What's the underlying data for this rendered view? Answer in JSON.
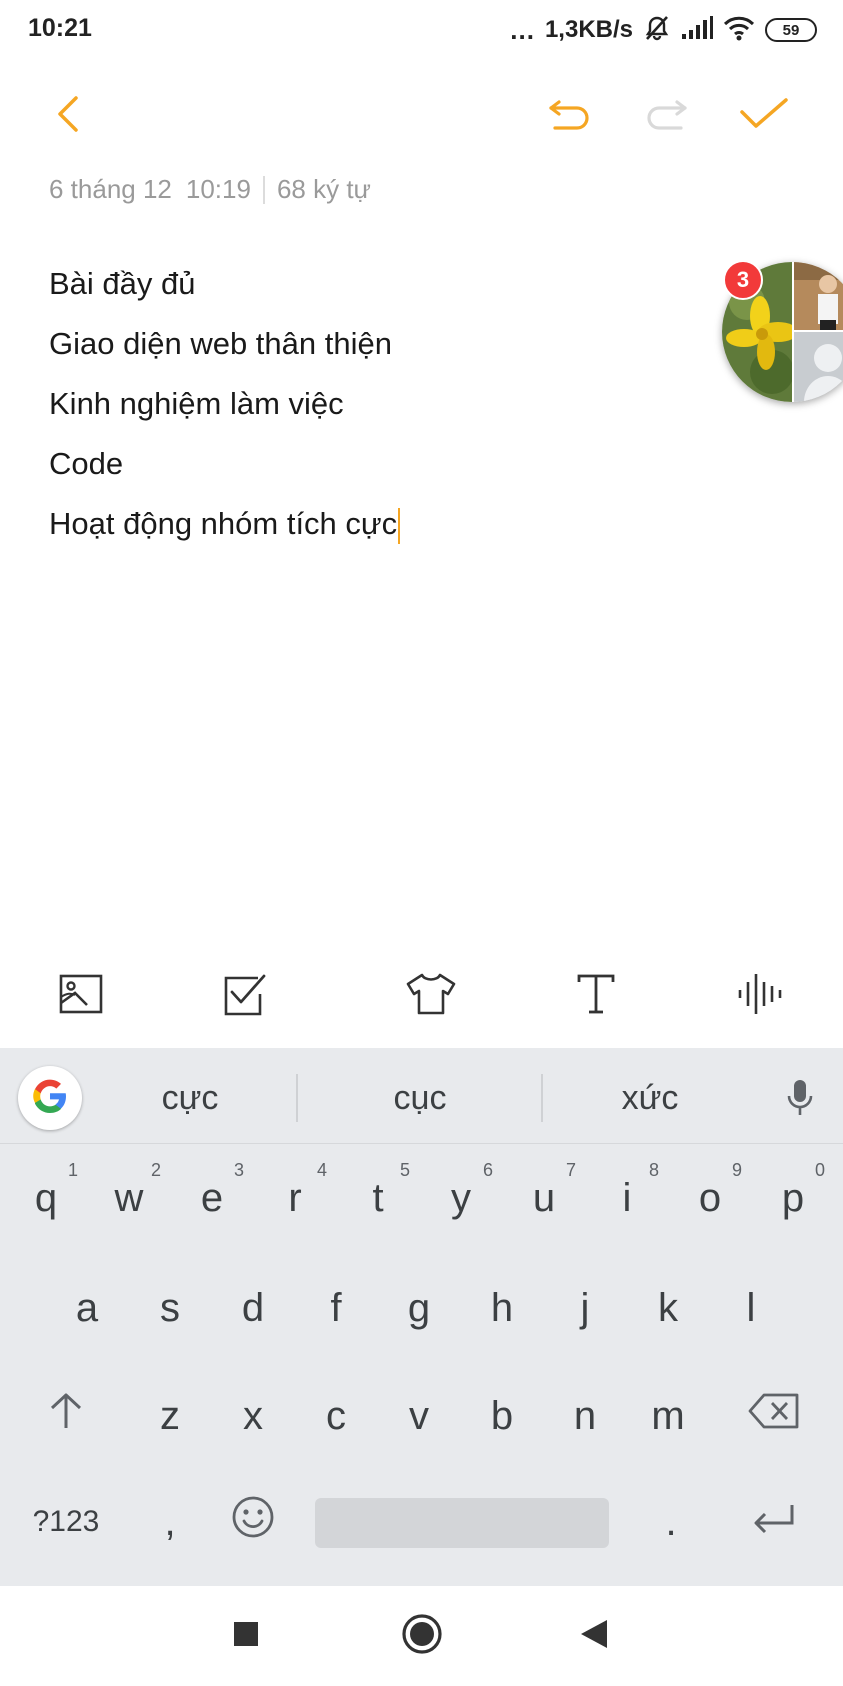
{
  "status_bar": {
    "time": "10:21",
    "dots": "...",
    "net_speed": "1,3KB/s",
    "battery": "59",
    "icons": [
      "mute-icon",
      "signal-icon",
      "wifi-icon",
      "battery-icon"
    ]
  },
  "toolbar": {
    "back_icon": "chevron-left-icon",
    "undo_icon": "undo-icon",
    "redo_icon": "redo-icon",
    "done_icon": "checkmark-icon",
    "accent_color": "#f5a623",
    "disabled_color": "#d9d9d9"
  },
  "note": {
    "date": "6 tháng 12",
    "time": "10:19",
    "char_count": "68 ký tự",
    "lines": [
      "Bài đầy đủ",
      "Giao diện web thân thiện",
      "Kinh nghiệm làm việc",
      "Code",
      "Hoạt động nhóm tích cực"
    ]
  },
  "chat_bubble": {
    "badge_count": "3"
  },
  "format_bar": {
    "items": [
      "image-icon",
      "checklist-icon",
      "theme-shirt-icon",
      "text-format-icon",
      "voice-wave-icon"
    ]
  },
  "keyboard": {
    "suggestions": [
      "cực",
      "cục",
      "xức"
    ],
    "row1": [
      {
        "k": "q",
        "n": "1"
      },
      {
        "k": "w",
        "n": "2"
      },
      {
        "k": "e",
        "n": "3"
      },
      {
        "k": "r",
        "n": "4"
      },
      {
        "k": "t",
        "n": "5"
      },
      {
        "k": "y",
        "n": "6"
      },
      {
        "k": "u",
        "n": "7"
      },
      {
        "k": "i",
        "n": "8"
      },
      {
        "k": "o",
        "n": "9"
      },
      {
        "k": "p",
        "n": "0"
      }
    ],
    "row2": [
      "a",
      "s",
      "d",
      "f",
      "g",
      "h",
      "j",
      "k",
      "l"
    ],
    "row3": [
      "z",
      "x",
      "c",
      "v",
      "b",
      "n",
      "m"
    ],
    "symbols_label": "?123",
    "comma": ",",
    "period": "."
  },
  "nav_bar": {
    "icons": [
      "recents-square-icon",
      "home-circle-icon",
      "back-triangle-icon"
    ]
  }
}
